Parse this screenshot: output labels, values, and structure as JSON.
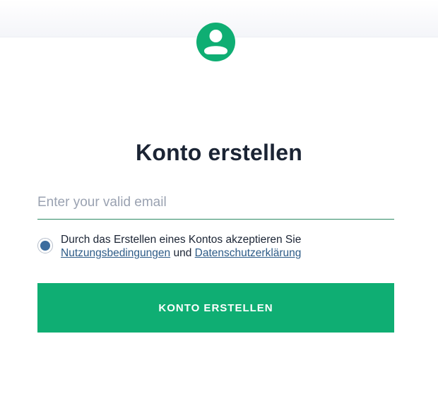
{
  "header": {
    "avatar_icon": "user-circle-icon"
  },
  "form": {
    "title": "Konto erstellen",
    "email_placeholder": "Enter your valid email",
    "consent": {
      "text_before": "Durch das Erstellen eines Kontos akzeptieren Sie",
      "terms_link": "Nutzungsbedingungen",
      "connector": "und",
      "privacy_link": "Datenschutzerklärung",
      "checked": true
    },
    "submit_label": "KONTO ERSTELLEN"
  },
  "colors": {
    "accent": "#0fae73",
    "title": "#1b2434",
    "link": "#2d5b87",
    "radio_fill": "#3d6d9e"
  }
}
